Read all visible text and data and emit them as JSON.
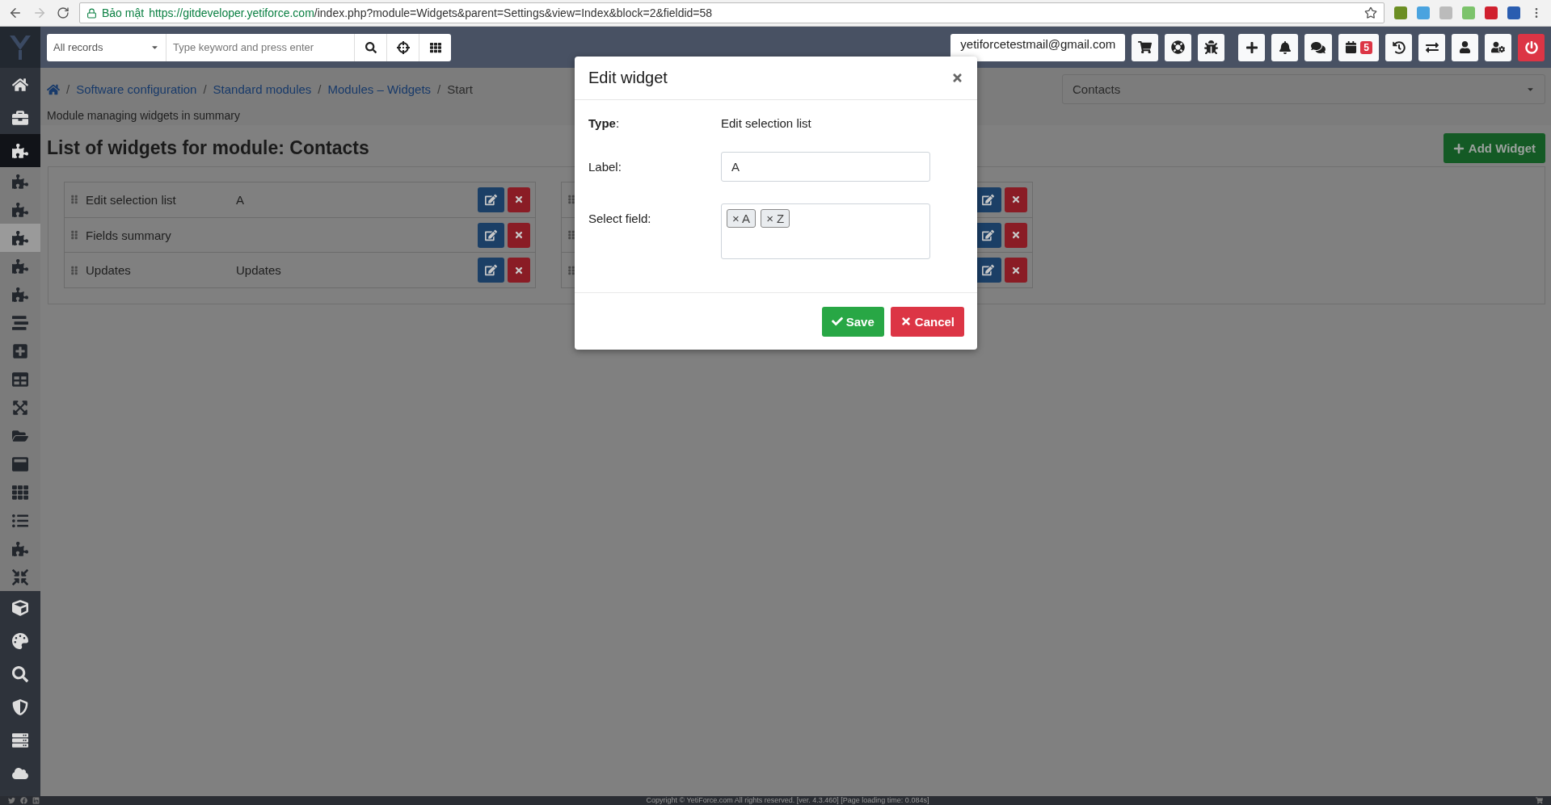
{
  "browser": {
    "security_label": "Bảo mật",
    "url_host": "https://gitdeveloper.yetiforce.com",
    "url_path": "/index.php?module=Widgets&parent=Settings&view=Index&block=2&fieldid=58"
  },
  "navbar": {
    "records_select": "All records",
    "search": {
      "placeholder": "Type keyword and press enter"
    },
    "email": "yetiforcetestmail@gmail.com",
    "calendar_badge": "5"
  },
  "sidebar": {
    "items": [
      {
        "kind": "section",
        "expanded": false
      },
      {
        "kind": "section",
        "expanded": false
      },
      {
        "kind": "section",
        "expanded": true
      },
      {
        "kind": "item",
        "selected": false
      },
      {
        "kind": "item",
        "selected": false
      },
      {
        "kind": "item",
        "selected": true
      },
      {
        "kind": "item",
        "selected": false
      },
      {
        "kind": "item",
        "selected": false
      },
      {
        "kind": "item",
        "selected": false
      },
      {
        "kind": "item",
        "selected": false
      },
      {
        "kind": "item",
        "selected": false
      },
      {
        "kind": "item",
        "selected": false
      },
      {
        "kind": "item",
        "selected": false
      },
      {
        "kind": "item",
        "selected": false
      },
      {
        "kind": "item",
        "selected": false
      },
      {
        "kind": "item",
        "selected": false
      },
      {
        "kind": "item",
        "selected": false
      },
      {
        "kind": "item",
        "selected": false
      },
      {
        "kind": "section",
        "expanded": false
      },
      {
        "kind": "section",
        "expanded": false
      },
      {
        "kind": "section",
        "expanded": false
      },
      {
        "kind": "section",
        "expanded": false
      },
      {
        "kind": "section",
        "expanded": false
      },
      {
        "kind": "section",
        "expanded": false
      }
    ]
  },
  "breadcrumb": {
    "separator": "/",
    "items": [
      "Software configuration",
      "Standard modules",
      "Modules – Widgets",
      "Start"
    ]
  },
  "description": "Module managing widgets in summary",
  "title": "List of widgets for module: Contacts",
  "module_select": "Contacts",
  "add_button": "Add Widget",
  "columns": [
    {
      "widgets": [
        {
          "kind": "widget",
          "type": "Edit selection list",
          "label": "A"
        },
        {
          "kind": "widget",
          "type": "Fields summary"
        },
        {
          "kind": "widget",
          "type": "Updates",
          "label": "Updates"
        }
      ]
    },
    {
      "widgets": [
        {
          "kind": "covered"
        },
        {
          "kind": "covered"
        },
        {
          "kind": "covered"
        }
      ]
    }
  ],
  "modal": {
    "title": "Edit widget",
    "type_label": "**Type**:",
    "type_value": "Edit selection list",
    "label_label": "Label:",
    "label_value": "A",
    "select_label": "Select field:",
    "tags": [
      {
        "remove": "×",
        "text": "A"
      },
      {
        "remove": "×",
        "text": "Z"
      }
    ],
    "save": "Save",
    "cancel": "Cancel"
  },
  "footer": "Copyright © YetiForce.com All rights reserved. [ver. 4.3.460] [Page loading time: 0.084s]"
}
